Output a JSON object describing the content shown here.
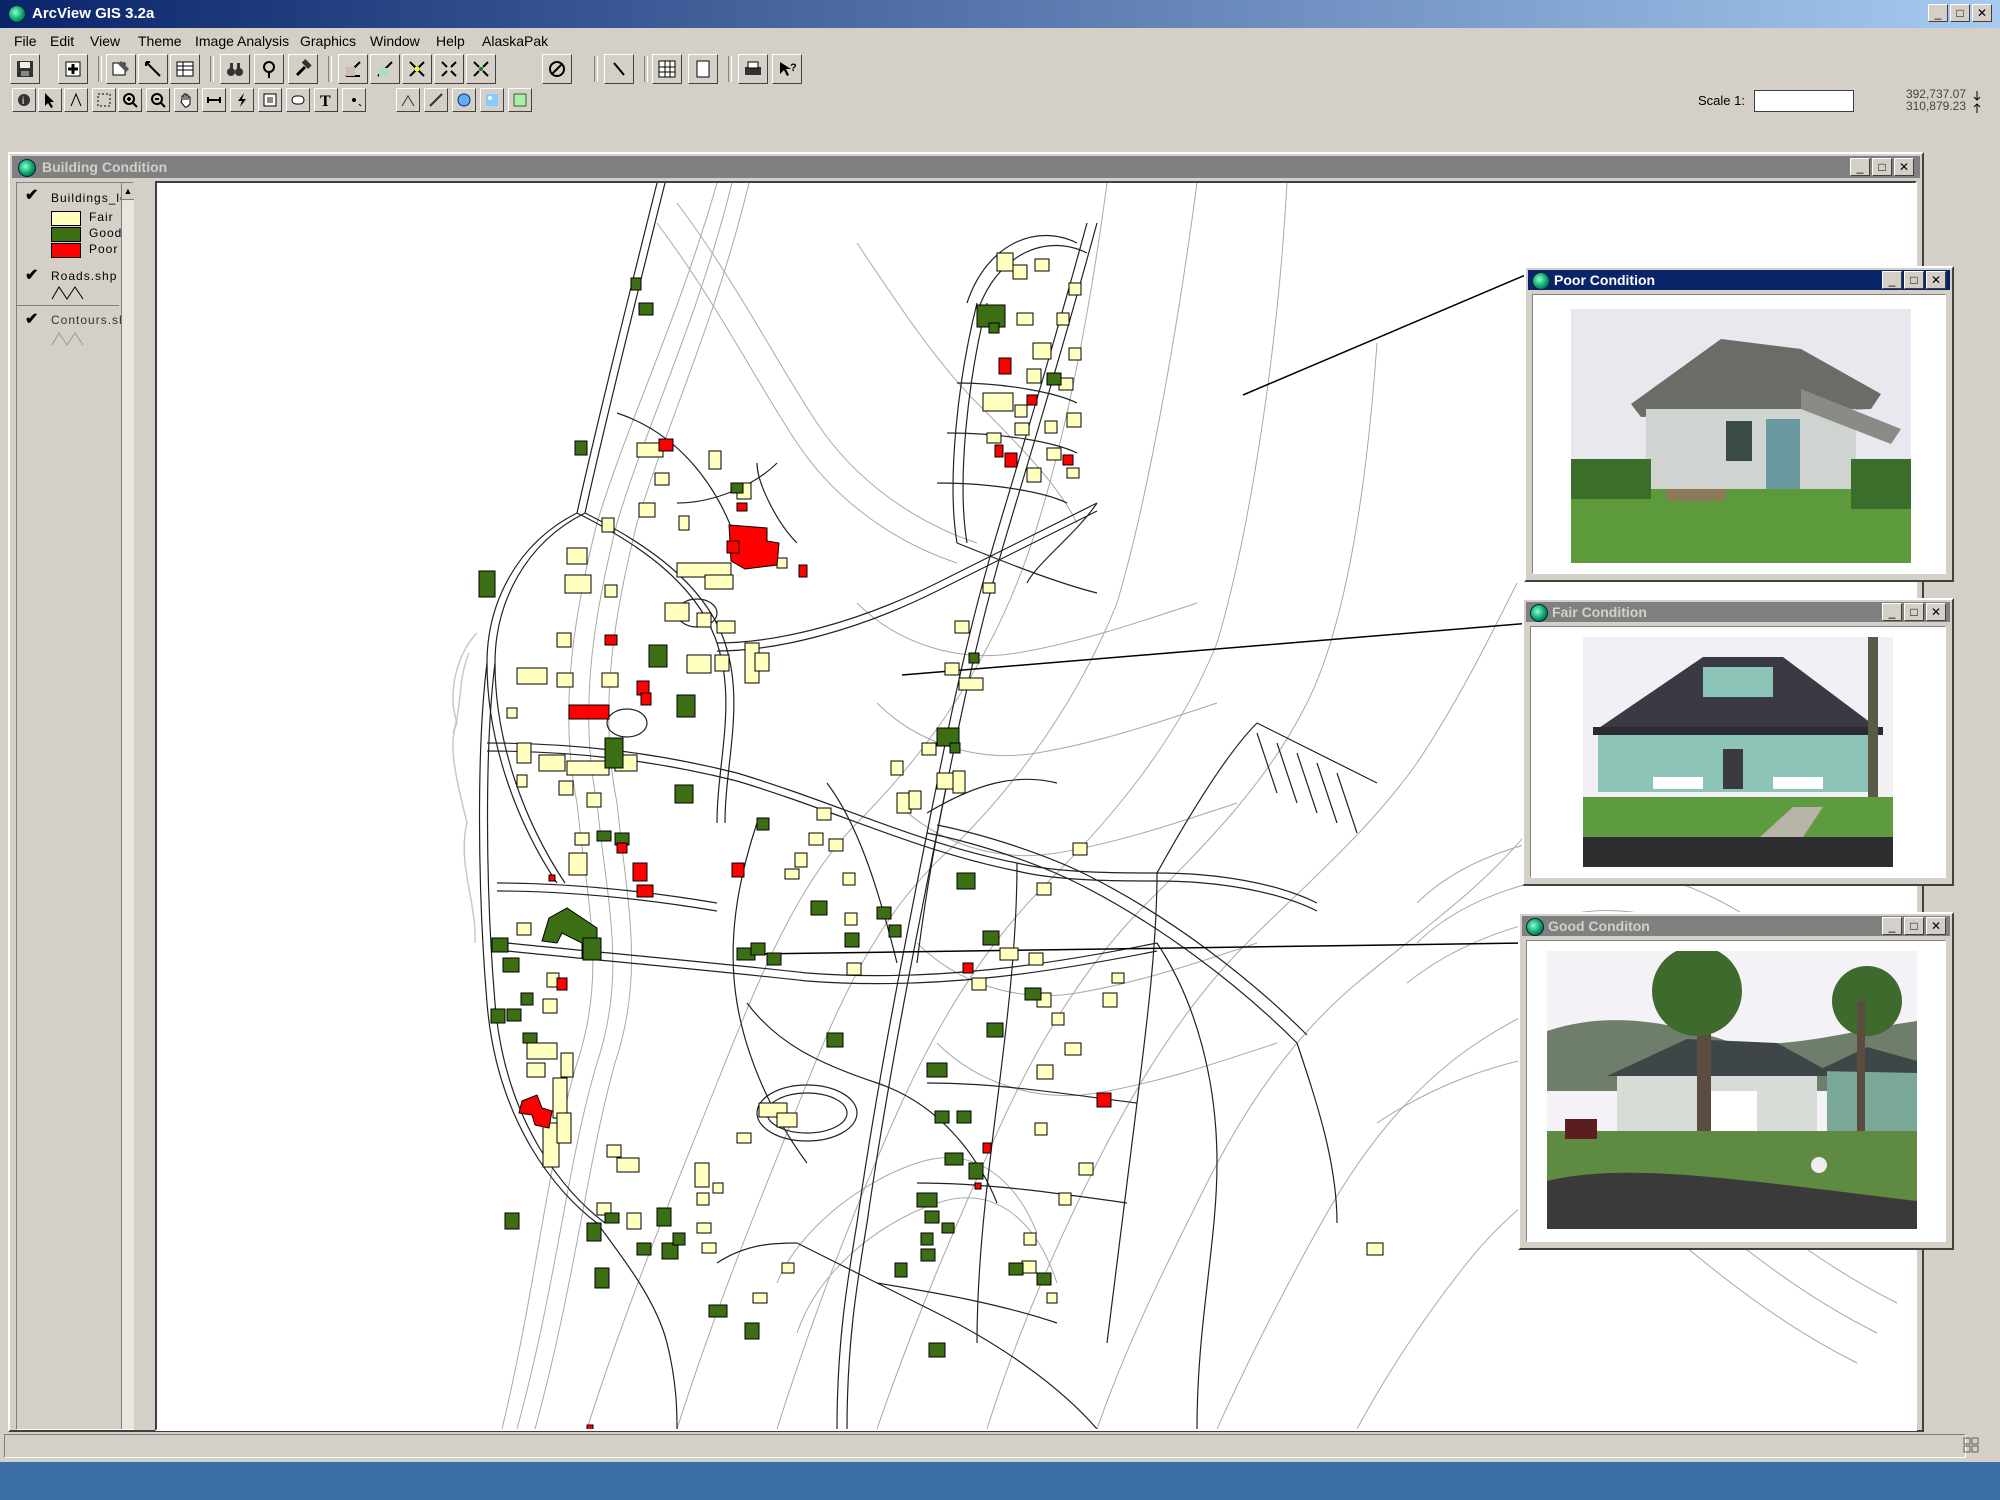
{
  "app": {
    "title": "ArcView GIS 3.2a",
    "window_buttons": [
      "_",
      "□",
      "✕"
    ]
  },
  "menu": {
    "items": [
      "File",
      "Edit",
      "View",
      "Theme",
      "Image Analysis",
      "Graphics",
      "Window",
      "Help",
      "AlaskaPak"
    ]
  },
  "toolbar": {
    "scale_label": "Scale 1:",
    "scale_value": "",
    "coord_x": "392,737.07",
    "coord_y": "310,879.23"
  },
  "view": {
    "title": "Building Condition",
    "window_buttons": [
      "_",
      "□",
      "✕"
    ]
  },
  "toc": {
    "themes": [
      {
        "name": "Buildings_lo",
        "checked": true,
        "legend": [
          {
            "label": "Fair",
            "color": "#ffffc0"
          },
          {
            "label": "Good",
            "color": "#3c6e14"
          },
          {
            "label": "Poor",
            "color": "#ff0000"
          }
        ]
      },
      {
        "name": "Roads.shp",
        "checked": true
      },
      {
        "name": "Contours.sh",
        "checked": true
      }
    ]
  },
  "photo_windows": [
    {
      "title": "Poor Condition",
      "active": true
    },
    {
      "title": "Fair Condition",
      "active": false
    },
    {
      "title": "Good Conditon",
      "active": false
    }
  ],
  "colors": {
    "fair": "#ffffc0",
    "good": "#3c6e14",
    "poor": "#ff0000",
    "title_active": "#0a246a",
    "title_inactive": "#808080"
  }
}
